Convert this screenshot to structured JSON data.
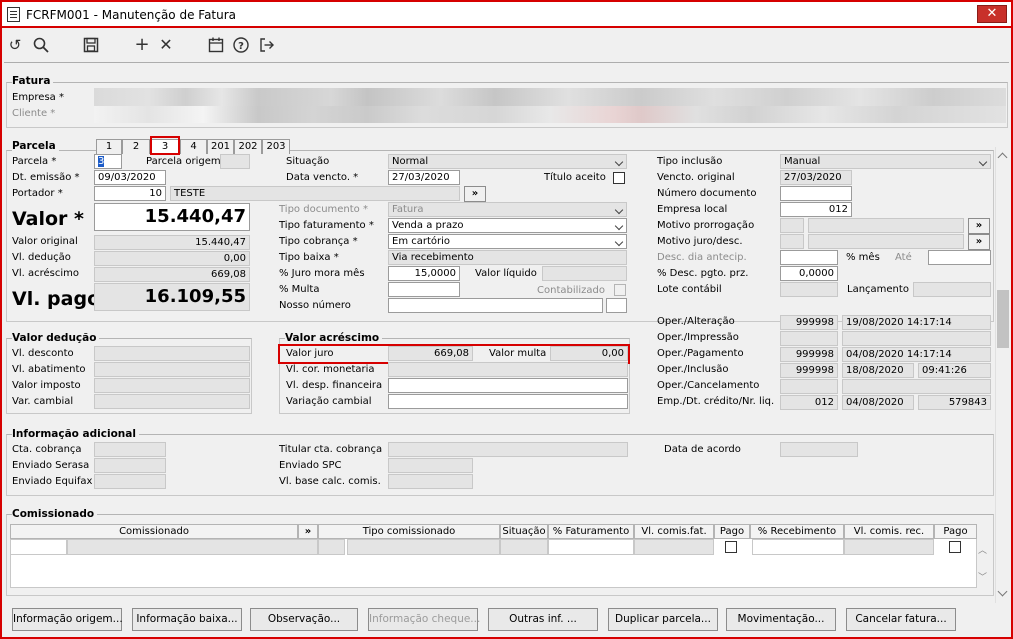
{
  "window": {
    "title": "FCRFM001 - Manutenção de Fatura",
    "close_label": "✕"
  },
  "fatura": {
    "title": "Fatura",
    "empresa_label": "Empresa *",
    "cliente_label": "Cliente *"
  },
  "parcela": {
    "title": "Parcela",
    "tabs": [
      "1",
      "2",
      "3",
      "4",
      "201",
      "202",
      "203"
    ],
    "parcela_label": "Parcela *",
    "parcela_value": "3",
    "parcela_origem_label": "Parcela origem",
    "dt_emissao_label": "Dt. emissão *",
    "dt_emissao": "09/03/2020",
    "portador_label": "Portador *",
    "portador_code": "10",
    "portador_name": "TESTE",
    "valor_label": "Valor *",
    "valor": "15.440,47",
    "valor_original_label": "Valor original",
    "valor_original": "15.440,47",
    "vl_deducao_label": "Vl. dedução",
    "vl_deducao": "0,00",
    "vl_acrescimo_label": "Vl. acréscimo",
    "vl_acrescimo": "669,08",
    "vl_pago_label": "Vl. pago",
    "vl_pago": "16.109,55",
    "situacao_label": "Situação",
    "situacao": "Normal",
    "data_vencto_label": "Data vencto. *",
    "data_vencto": "27/03/2020",
    "titulo_aceito_label": "Título aceito",
    "tipo_documento_label": "Tipo documento *",
    "tipo_documento": "Fatura",
    "tipo_faturamento_label": "Tipo faturamento *",
    "tipo_faturamento": "Venda a prazo",
    "tipo_cobranca_label": "Tipo cobrança *",
    "tipo_cobranca": "Em cartório",
    "tipo_baixa_label": "Tipo baixa *",
    "tipo_baixa": "Via recebimento",
    "juro_mora_label": "% Juro mora mês",
    "juro_mora": "15,0000",
    "valor_liquido_label": "Valor líquido",
    "multa_label": "% Multa",
    "contabilizado_label": "Contabilizado",
    "nosso_numero_label": "Nosso número",
    "tipo_inclusao_label": "Tipo inclusão",
    "tipo_inclusao": "Manual",
    "vencto_original_label": "Vencto. original",
    "vencto_original": "27/03/2020",
    "numero_documento_label": "Número documento",
    "empresa_local_label": "Empresa local",
    "empresa_local": "012",
    "motivo_prorrogacao_label": "Motivo prorrogação",
    "motivo_juro_label": "Motivo juro/desc.",
    "desc_dia_antecip_label": "Desc. dia antecip.",
    "pct_mes_label": "% mês",
    "ate_label": "Até",
    "desc_pgto_label": "% Desc. pgto. prz.",
    "desc_pgto": "0,0000",
    "lote_contabil_label": "Lote contábil",
    "lancamento_label": "Lançamento",
    "lookup_btn": "»"
  },
  "valor_deducao": {
    "title": "Valor dedução",
    "vl_desconto_label": "Vl. desconto",
    "vl_abatimento_label": "Vl. abatimento",
    "valor_imposto_label": "Valor imposto",
    "var_cambial_label": "Var. cambial"
  },
  "valor_acrescimo": {
    "title": "Valor acréscimo",
    "valor_juro_label": "Valor juro",
    "valor_juro": "669,08",
    "valor_multa_label": "Valor multa",
    "valor_multa": "0,00",
    "vl_cor_monetaria_label": "Vl. cor. monetaria",
    "vl_desp_financeira_label": "Vl. desp. financeira",
    "variacao_cambial_label": "Variação cambial"
  },
  "operacoes": {
    "alteracao_label": "Oper./Alteração",
    "alteracao_user": "999998",
    "alteracao_dt": "19/08/2020 14:17:14",
    "impressao_label": "Oper./Impressão",
    "pagamento_label": "Oper./Pagamento",
    "pagamento_user": "999998",
    "pagamento_dt": "04/08/2020 14:17:14",
    "inclusao_label": "Oper./Inclusão",
    "inclusao_user": "999998",
    "inclusao_date": "18/08/2020",
    "inclusao_time": "09:41:26",
    "cancelamento_label": "Oper./Cancelamento",
    "emp_label": "Emp./Dt. crédito/Nr. liq.",
    "emp_code": "012",
    "emp_date": "04/08/2020",
    "emp_nr": "579843"
  },
  "info_adicional": {
    "title": "Informação adicional",
    "cta_cobranca_label": "Cta. cobrança",
    "enviado_serasa_label": "Enviado Serasa",
    "enviado_equifax_label": "Enviado Equifax",
    "titular_label": "Titular cta. cobrança",
    "enviado_spc_label": "Enviado SPC",
    "vl_base_label": "Vl. base calc. comis.",
    "data_acordo_label": "Data de acordo"
  },
  "comissionado": {
    "title": "Comissionado",
    "columns": [
      "Comissionado",
      "»",
      "Tipo comissionado",
      "Situação",
      "% Faturamento",
      "Vl. comis.fat.",
      "Pago",
      "% Recebimento",
      "Vl. comis. rec.",
      "Pago"
    ]
  },
  "buttons": [
    "Informação origem...",
    "Informação baixa...",
    "Observação...",
    "Informação cheque...",
    "Outras inf. ...",
    "Duplicar parcela...",
    "Movimentação...",
    "Cancelar fatura..."
  ],
  "colors": {
    "highlight": "#d60000"
  }
}
